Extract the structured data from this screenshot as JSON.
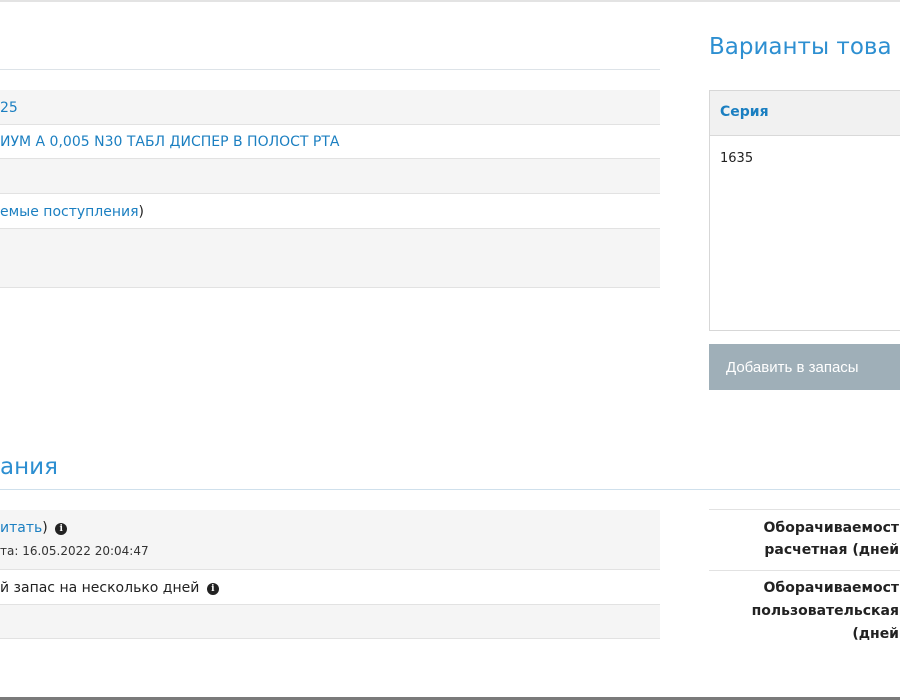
{
  "top_panel": {
    "row1_link": "25",
    "row2_link": "ИУМ А 0,005 N30 ТАБЛ ДИСПЕР В ПОЛОСТ РТА",
    "row4_link": "емые поступления",
    "row4_suffix": ")"
  },
  "variants": {
    "heading": "Варианты това",
    "column_header": "Серия",
    "series_value": "1635",
    "add_button": "Добавить в запасы"
  },
  "section": {
    "heading": "ания",
    "row1_link": "итать",
    "row1_suffix": ")",
    "row1_date": "та: 16.05.2022 20:04:47",
    "row2_text": "й запас на несколько дней",
    "turnover_calc_line1": "Оборачиваемост",
    "turnover_calc_line2": "расчетная (дней",
    "turnover_user_line1": "Оборачиваемост",
    "turnover_user_line2": "пользовательская",
    "turnover_user_line3": "(дней"
  },
  "icons": {
    "info": "info-icon"
  }
}
